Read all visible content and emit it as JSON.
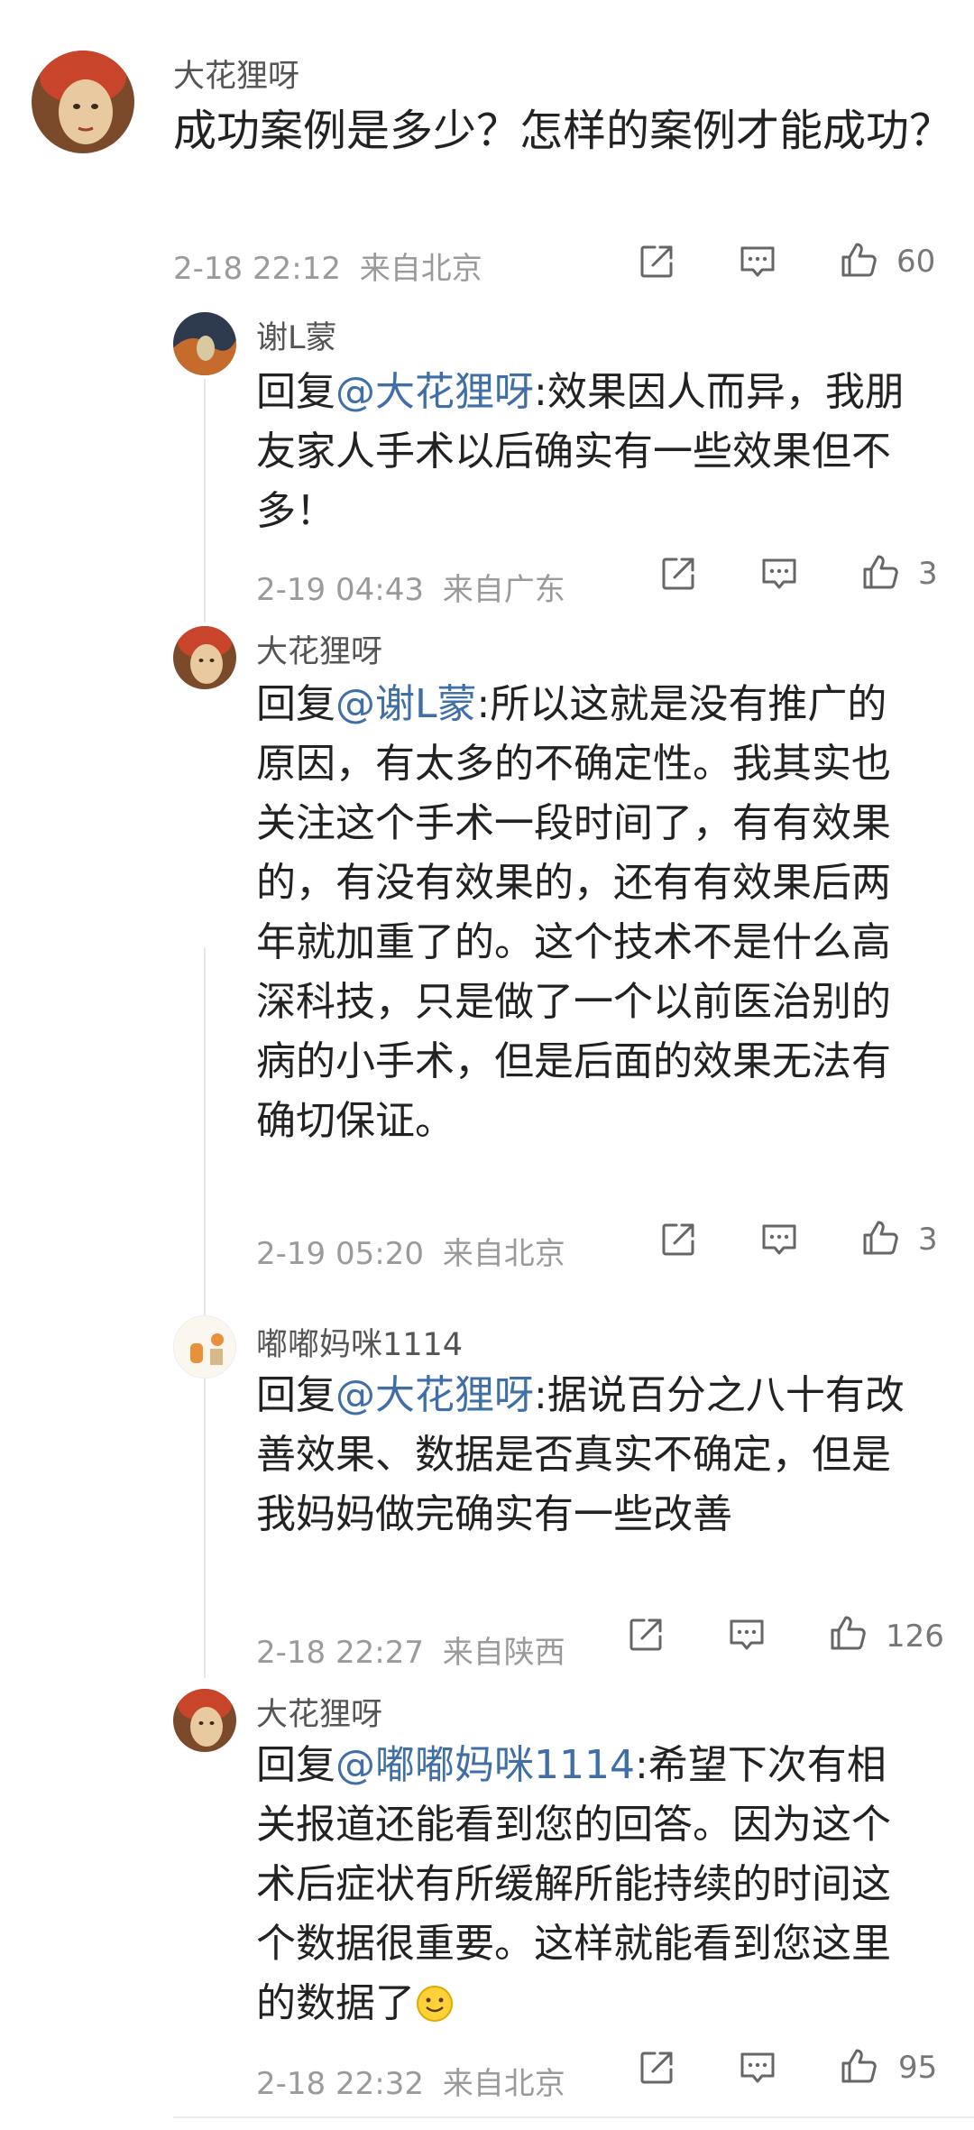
{
  "main_comment": {
    "username": "大花狸呀",
    "text": "成功案例是多少？怎样的案例才能成功？",
    "time": "2-18 22:12",
    "location": "来自北京",
    "likes": "60"
  },
  "replies": [
    {
      "username": "谢L蒙",
      "reply_prefix": "回复",
      "mention": "@大花狸呀",
      "text": ":效果因人而异，我朋友家人手术以后确实有一些效果但不多！",
      "time": "2-19 04:43",
      "location": "来自广东",
      "likes": "3"
    },
    {
      "username": "大花狸呀",
      "reply_prefix": "回复",
      "mention": "@谢L蒙",
      "text": ":所以这就是没有推广的原因，有太多的不确定性。我其实也关注这个手术一段时间了，有有效果的，有没有效果的，还有有效果后两年就加重了的。这个技术不是什么高深科技，只是做了一个以前医治别的病的小手术，但是后面的效果无法有确切保证。",
      "time": "2-19 05:20",
      "location": "来自北京",
      "likes": "3"
    },
    {
      "username": "嘟嘟妈咪1114",
      "reply_prefix": "回复",
      "mention": "@大花狸呀",
      "text": ":据说百分之八十有改善效果、数据是否真实不确定，但是我妈妈做完确实有一些改善",
      "time": "2-18 22:27",
      "location": "来自陕西",
      "likes": "126"
    },
    {
      "username": "大花狸呀",
      "reply_prefix": "回复",
      "mention": "@嘟嘟妈咪1114",
      "text": ":希望下次有相关报道还能看到您的回答。因为这个术后症状有所缓解所能持续的时间这个数据很重要。这样就能看到您这里的数据了",
      "time": "2-18 22:32",
      "location": "来自北京",
      "likes": "95"
    }
  ],
  "icons": {
    "share": "share-icon",
    "comment": "comment-icon",
    "like": "thumbs-up-icon",
    "emoji": "smile-emoji-icon"
  },
  "colors": {
    "mention": "#3f6fa6",
    "meta": "#9a9a9a"
  }
}
